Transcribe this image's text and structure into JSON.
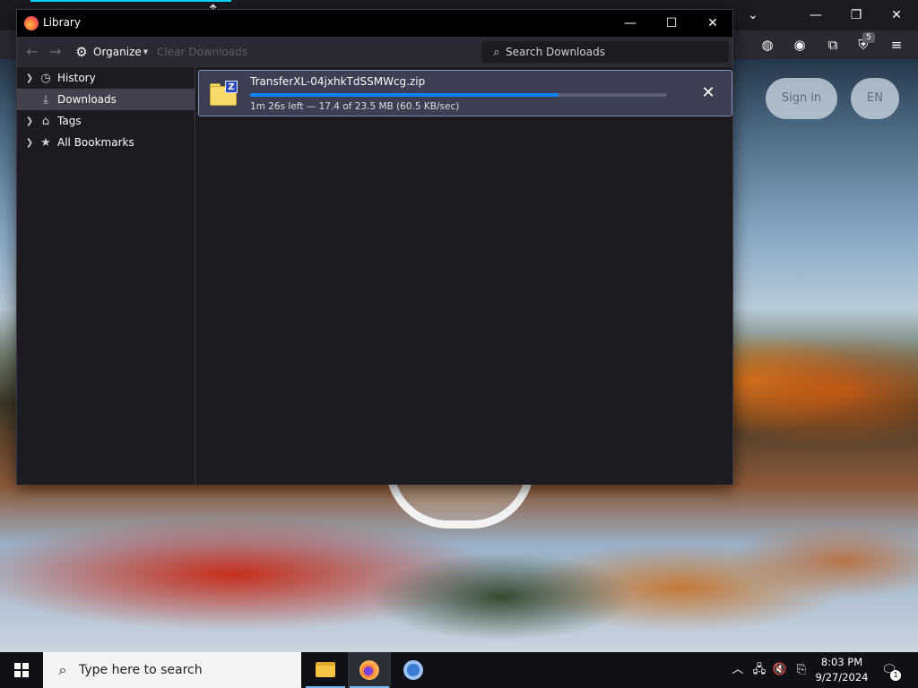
{
  "library": {
    "title": "Library",
    "toolbar": {
      "back_icon": "arrow-left-icon",
      "forward_icon": "arrow-right-icon",
      "organize_label": "Organize",
      "clear_downloads_label": "Clear Downloads",
      "search_placeholder": "Search Downloads",
      "search_value": ""
    },
    "sidebar": {
      "items": [
        {
          "label": "History",
          "icon": "clock-icon",
          "expandable": true,
          "selected": false
        },
        {
          "label": "Downloads",
          "icon": "download-icon",
          "expandable": false,
          "selected": true
        },
        {
          "label": "Tags",
          "icon": "tags-icon",
          "expandable": true,
          "selected": false
        },
        {
          "label": "All Bookmarks",
          "icon": "star-icon",
          "expandable": true,
          "selected": false
        }
      ]
    },
    "downloads": [
      {
        "filename": "TransferXL-04jxhkTdSSMWcg.zip",
        "status": "1m 26s left — 17.4 of 23.5 MB (60.5 KB/sec)",
        "progress_fraction": 0.74
      }
    ]
  },
  "browser": {
    "extension_badge": "5",
    "sign_in_label": "Sign in",
    "language_label": "EN"
  },
  "taskbar": {
    "search_placeholder": "Type here to search",
    "time": "8:03 PM",
    "date": "9/27/2024",
    "notification_count": "1"
  },
  "colors": {
    "accent": "#0a84ff",
    "window_bg": "#1c1b22",
    "toolbar_bg": "#2b2a33",
    "selected_item": "#42414d",
    "download_item_bg": "#3b3f51"
  }
}
